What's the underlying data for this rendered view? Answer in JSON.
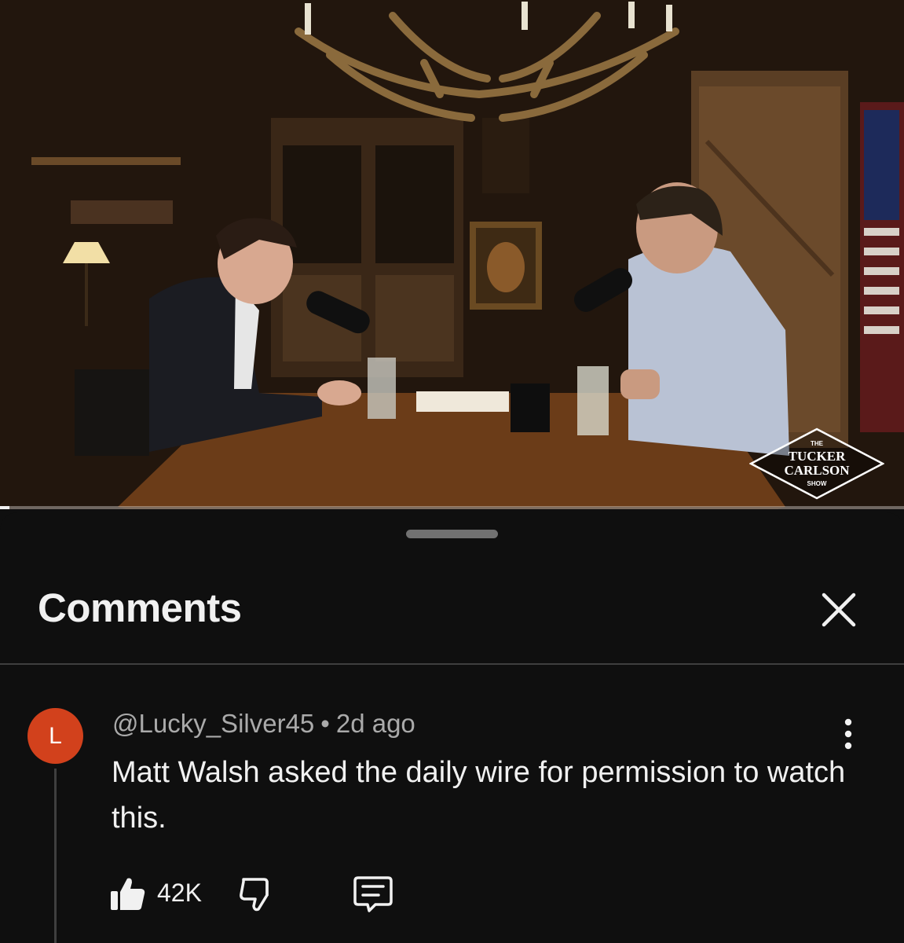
{
  "video": {
    "progress_fraction": 0.01,
    "logo": {
      "line1": "THE",
      "line2": "TUCKER",
      "line3": "CARLSON",
      "line4": "SHOW"
    }
  },
  "comments_panel": {
    "title": "Comments",
    "close_icon": "close-icon",
    "comment": {
      "avatar_letter": "L",
      "avatar_color": "#d2411c",
      "author": "@Lucky_Silver45",
      "separator": "•",
      "time": "2d ago",
      "text": "Matt Walsh asked the daily wire for permission to watch this.",
      "like_count": "42K",
      "icons": [
        "thumbs-up-icon",
        "thumbs-down-icon",
        "reply-icon",
        "more-vertical-icon"
      ]
    }
  },
  "colors": {
    "background": "#0f0f0f",
    "primary_text": "#f1f1f1",
    "secondary_text": "#aaaaaa",
    "divider": "#3f3f3f"
  }
}
